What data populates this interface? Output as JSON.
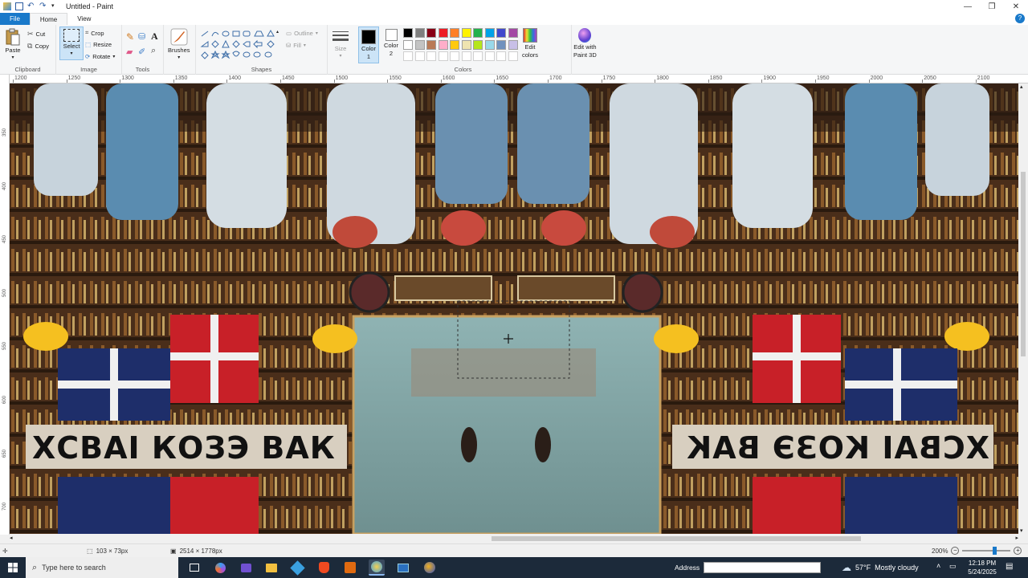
{
  "window": {
    "title": "Untitled - Paint",
    "controls": {
      "minimize": "—",
      "maximize": "❐",
      "close": "✕"
    }
  },
  "menu": {
    "file": "File",
    "home": "Home",
    "view": "View",
    "help": "?"
  },
  "ribbon": {
    "clipboard": {
      "paste": "Paste",
      "cut": "Cut",
      "copy": "Copy",
      "label": "Clipboard"
    },
    "image": {
      "select": "Select",
      "crop": "Crop",
      "resize": "Resize",
      "rotate": "Rotate",
      "label": "Image"
    },
    "tools": {
      "label": "Tools",
      "text": "A"
    },
    "brushes": {
      "label": "Brushes"
    },
    "shapes": {
      "outline": "Outline",
      "fill": "Fill",
      "label": "Shapes"
    },
    "size": {
      "label": "Size"
    },
    "color1": {
      "line1": "Color",
      "line2": "1"
    },
    "color2": {
      "line1": "Color",
      "line2": "2"
    },
    "colors": {
      "label": "Colors"
    },
    "edit_colors": {
      "line1": "Edit",
      "line2": "colors"
    },
    "paint3d": {
      "line1": "Edit with",
      "line2": "Paint 3D"
    }
  },
  "palette": [
    "#000000",
    "#7f7f7f",
    "#880015",
    "#ed1c24",
    "#ff7f27",
    "#fff200",
    "#22b14c",
    "#00a2e8",
    "#3f48cc",
    "#a349a4",
    "#ffffff",
    "#c3c3c3",
    "#b97a57",
    "#ffaec9",
    "#ffc90e",
    "#efe4b0",
    "#b5e61d",
    "#99d9ea",
    "#7092be",
    "#c8bfe7"
  ],
  "ruler": {
    "top": [
      "1200",
      "1250",
      "1300",
      "1350",
      "1400",
      "1450",
      "1500",
      "1550",
      "1600",
      "1650",
      "1700",
      "1750",
      "1800",
      "1850",
      "1900",
      "1950",
      "2000",
      "2050",
      "2100"
    ],
    "left": [
      "350",
      "400",
      "450",
      "500",
      "550",
      "600",
      "650",
      "700"
    ]
  },
  "canvas": {
    "banner_text_left": "ХСВАІ КОЗЭ ВАК",
    "banner_text_right": "ХСВАІ КОЗЭ ВАК"
  },
  "status": {
    "selection_size": "103 × 73px",
    "image_size": "2514 × 1778px",
    "zoom": "200%"
  },
  "taskbar": {
    "search_placeholder": "Type here to search",
    "address_label": "Address",
    "weather_temp": "57°F",
    "weather_desc": "Mostly cloudy",
    "time": "12:18 PM",
    "date": "5/24/2025"
  },
  "colors": {
    "accent": "#1979ca",
    "taskbar": "#1c2a3a"
  }
}
